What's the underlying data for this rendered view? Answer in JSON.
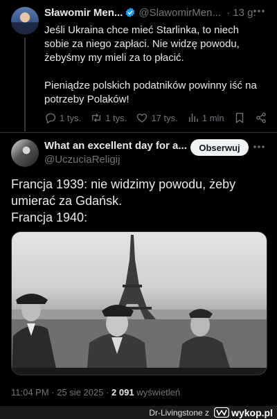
{
  "tweet1": {
    "name": "Sławomir Men...",
    "handle": "@SlawomirMen...",
    "time": "· 13 g.",
    "paragraphs": [
      "Jeśli Ukraina chce mieć Starlinka, to niech sobie za niego zapłaci. Nie widzę powodu, żebyśmy my mieli za to płacić.",
      "Pieniądze polskich podatników powinny iść na potrzeby Polaków!"
    ],
    "replies": "1 tys.",
    "reposts": "1 tys.",
    "likes": "17 tys.",
    "views": "1 mln",
    "colors": {
      "verified": "#1d9bf0",
      "muted": "#71767b"
    }
  },
  "tweet2": {
    "name": "What an excellent day for a...",
    "handle": "@UczuciaReligij",
    "follow_label": "Obserwuj",
    "lines": [
      "Francja 1939: nie widzimy powodu, żeby umierać za Gdańsk.",
      "Francja 1940:"
    ],
    "photo_alt": "black-and-white photo of three men in front of the Eiffel Tower",
    "time": "11:04 PM · 25 sie 2025 ·",
    "views_count": "2 091",
    "views_label": "wyświetleń"
  },
  "footer": {
    "user": "Dr-Livingstone z",
    "site": "wykop.pl"
  }
}
